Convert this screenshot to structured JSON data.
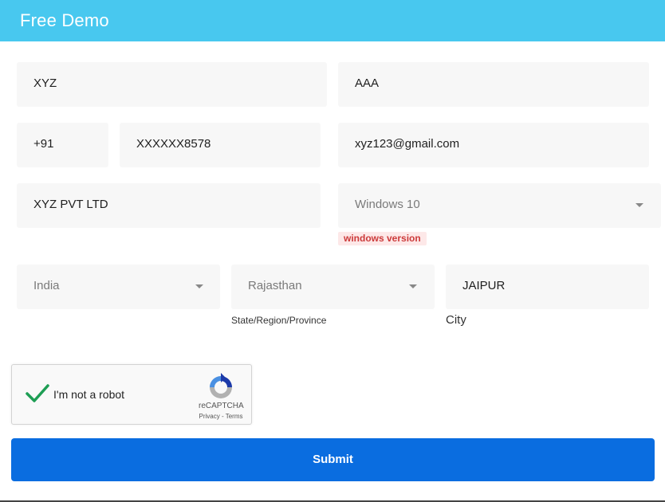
{
  "header": {
    "title": "Free Demo"
  },
  "form": {
    "first_name": "XYZ",
    "last_name": "AAA",
    "country_code": "+91",
    "phone": "XXXXXX8578",
    "email": "xyz123@gmail.com",
    "company": "XYZ PVT LTD",
    "windows_version": "Windows 10",
    "windows_version_badge": "windows version",
    "country": "India",
    "state": "Rajasthan",
    "state_label": "State/Region/Province",
    "city": "JAIPUR",
    "city_label": "City"
  },
  "captcha": {
    "label": "I'm not a robot",
    "brand": "reCAPTCHA",
    "links": "Privacy - Terms"
  },
  "submit": {
    "label": "Submit"
  },
  "colors": {
    "header": "#48c8ef",
    "submit": "#0a6de0",
    "check": "#1e9e54",
    "error": "#cc3a3a"
  }
}
